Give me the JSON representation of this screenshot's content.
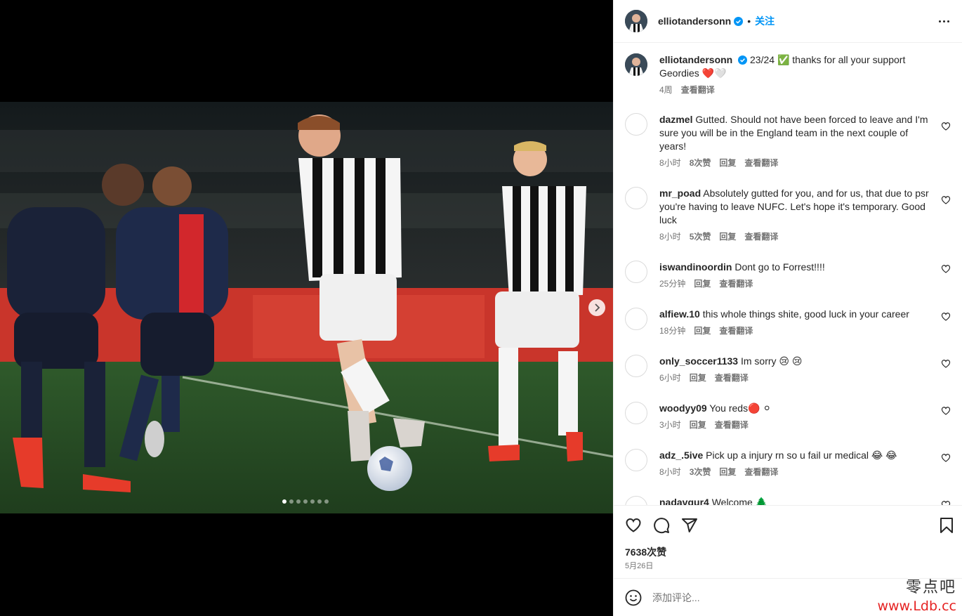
{
  "post": {
    "author": "elliotandersonn",
    "follow_label": "关注",
    "separator": "•",
    "caption": {
      "username": "elliotandersonn",
      "text": "23/24 ✅ thanks for all your support Geordies ❤️🤍",
      "time": "4周",
      "translate": "查看翻译"
    },
    "likes": "7638次赞",
    "date": "5月26日",
    "comment_placeholder": "添加评论...",
    "carousel": {
      "total": 7,
      "active": 1
    }
  },
  "comments": [
    {
      "username": "dazmel",
      "text": "Gutted. Should not have been forced to leave and I'm sure you will be in the England team in the next couple of years!",
      "time": "8小时",
      "likes": "8次赞",
      "reply": "回复",
      "translate": "查看翻译"
    },
    {
      "username": "mr_poad",
      "text": "Absolutely gutted for you, and for us, that due to psr you're having to leave NUFC. Let's hope it's temporary. Good luck",
      "time": "8小时",
      "likes": "5次赞",
      "reply": "回复",
      "translate": "查看翻译"
    },
    {
      "username": "iswandinoordin",
      "text": "Dont go to Forrest!!!!",
      "time": "25分钟",
      "likes": "",
      "reply": "回复",
      "translate": "查看翻译"
    },
    {
      "username": "alfiew.10",
      "text": "this whole things shite, good luck in your career",
      "time": "18分钟",
      "likes": "",
      "reply": "回复",
      "translate": "查看翻译"
    },
    {
      "username": "only_soccer1133",
      "text": "Im sorry 😢 😢",
      "time": "6小时",
      "likes": "",
      "reply": "回复",
      "translate": "查看翻译"
    },
    {
      "username": "woodyy09",
      "text": "You reds🔴 ⚪",
      "time": "3小时",
      "likes": "",
      "reply": "回复",
      "translate": "查看翻译"
    },
    {
      "username": "adz_.5ive",
      "text": "Pick up a injury rn so u fail ur medical 😂 😂",
      "time": "8小时",
      "likes": "3次赞",
      "reply": "回复",
      "translate": "查看翻译"
    },
    {
      "username": "nadavgur4",
      "text": "Welcome 🌲",
      "time": "",
      "likes": "",
      "reply": "",
      "translate": ""
    }
  ],
  "watermark": {
    "line1": "零点吧",
    "line2": "www.Ldb.cc"
  },
  "colors": {
    "accent": "#0095f6",
    "text": "#262626",
    "muted": "#737373",
    "border": "#efefef"
  },
  "icons": [
    "more-icon",
    "heart-icon",
    "comment-icon",
    "share-icon",
    "bookmark-icon",
    "emoji-icon",
    "verified-icon",
    "chevron-right-icon"
  ]
}
